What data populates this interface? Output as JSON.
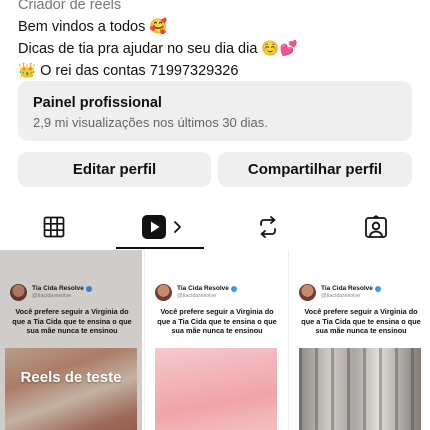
{
  "bio": {
    "category_partial": "Criador de reels",
    "line1": "Bem vindos a todos 🥰",
    "line2": "Dicas de tia pra ajudar no seu dia dia ☺️💕",
    "line3": "👑 O rei das contas 71997329326"
  },
  "professional_panel": {
    "title": "Painel profissional",
    "subtitle": "2,9 mi visualizações nos últimos 30 dias."
  },
  "actions": {
    "edit_label": "Editar perfil",
    "share_label": "Compartilhar perfil"
  },
  "tabs": [
    {
      "icon": "grid-icon",
      "active": false
    },
    {
      "icon": "reels-play-icon",
      "active": true,
      "chevron": "›"
    },
    {
      "icon": "repost-icon",
      "active": false
    },
    {
      "icon": "tagged-person-icon",
      "active": false
    }
  ],
  "posts": [
    {
      "author": "Tia Cida Resolve",
      "handle": "@tiacidaresolve",
      "caption": "Você prefere seguir a Virginia do que a Tia Cida que te ensina o que sua mãe nunca te ensinou",
      "overlay_label": "Reels de teste"
    },
    {
      "author": "Tia Cida Resolve",
      "handle": "@tiacidaresolve",
      "caption": "Você prefere seguir a Virginia do que a Tia Cida que te ensina o que sua mãe nunca te ensinou"
    },
    {
      "author": "Tia Cida Resolve",
      "handle": "@tiacidaresolve",
      "caption": "Você prefere seguir a Virginia do que a Tia Cida que te ensina o que sua mãe nunca te ensinou"
    }
  ],
  "colors": {
    "background": "#ffffff",
    "button_bg": "#efefef",
    "text": "#111111",
    "muted": "#666666",
    "verified_blue": "#3897f0"
  }
}
